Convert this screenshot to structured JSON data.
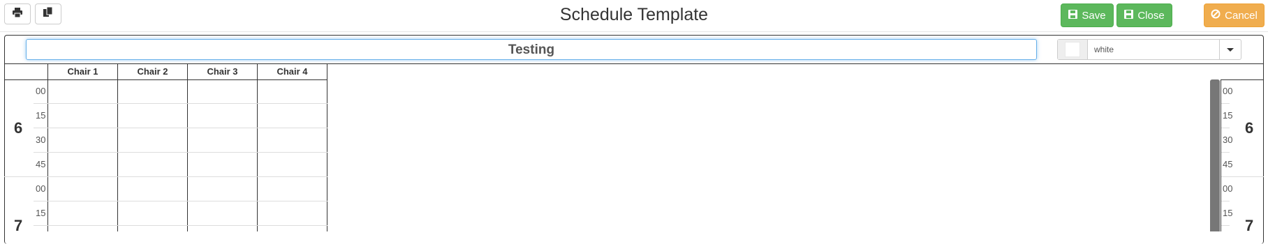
{
  "toolbar": {
    "print_icon": "print-icon",
    "copy_icon": "copy-icon"
  },
  "header": {
    "title": "Schedule Template"
  },
  "actions": {
    "save_label": "Save",
    "close_label": "Close",
    "cancel_label": "Cancel"
  },
  "template": {
    "name_value": "Testing",
    "color_value": "white"
  },
  "grid": {
    "columns": [
      "Chair 1",
      "Chair 2",
      "Chair 3",
      "Chair 4"
    ],
    "hours": [
      {
        "label": "6",
        "minutes": [
          "00",
          "15",
          "30",
          "45"
        ]
      },
      {
        "label": "7",
        "minutes": [
          "00",
          "15"
        ]
      }
    ]
  },
  "colors": {
    "success": "#5cb85c",
    "warning": "#f0ad4e",
    "focus": "#66afe9"
  }
}
